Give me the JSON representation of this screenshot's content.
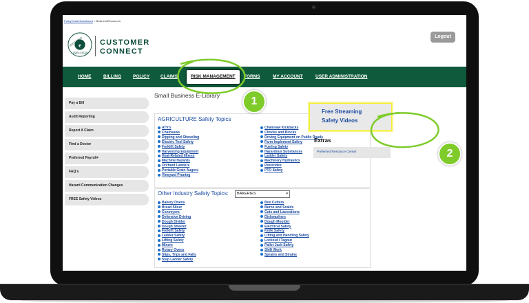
{
  "breadcrumb": {
    "home": "PolicyHolderDashboard",
    "current": "BusinessResources"
  },
  "brand": {
    "line1": "CUSTOMER",
    "line2": "CONNECT",
    "logo_text": "PREFERRED EMPLOYERS"
  },
  "header": {
    "logout_label": "Logout"
  },
  "nav": {
    "items": [
      "HOME",
      "BILLING",
      "POLICY",
      "CLAIMS",
      "RISK MANAGEMENT",
      "FORMS",
      "MY ACCOUNT",
      "USER ADMINISTRATION"
    ]
  },
  "sidebar": {
    "items": [
      "Pay a Bill",
      "Audit Reporting",
      "Report A Claim",
      "Find a Doctor",
      "Preferred Payroll+",
      "FAQ's",
      "Hazard Communication Changes",
      "FREE Safety Videos"
    ]
  },
  "library_title": "Small Business E-Library",
  "agriculture": {
    "title": "AGRICULTURE Safety Topics",
    "left": [
      "ATV's",
      "Chainsaws",
      "Dipping and Shoveling",
      "Electric Tool Safety",
      "Forklift Safety",
      "Harvesting Equipment",
      "Heat-Related Illness",
      "Machine Hazards",
      "Orchard Ladders",
      "Portable Grain Augers",
      "Vineyard Pruning"
    ],
    "right": [
      "Chainsaw Kickbacks",
      "Chocks and Blocks",
      "Driving Equipment on Public Roads",
      "Farm Implement Safety",
      "Fueling Safety",
      "Hazardous Substances",
      "Ladder Safety",
      "Machinery Hydraulics",
      "Pesticides",
      "PTO Safety"
    ]
  },
  "other": {
    "title": "Other Industry Safety Topics:",
    "selected": "BAKERIES",
    "left": [
      "Bakery Ovens",
      "Bread Slicer",
      "Conveyors",
      "Defensive Driving",
      "Dough Divider",
      "Dough Sheeter",
      "Forklift Safety",
      "Ladder Safety",
      "Lifting Safety",
      "Mixers",
      "Rotary Ovens",
      "Slips, Trips and Falls",
      "Step Ladder Safety"
    ],
    "right": [
      "Box Cutters",
      "Burns and Scalds",
      "Cuts and Lacerations",
      "Dishwashers",
      "Dough Moulder",
      "Electrical Safety",
      "Knife Safety",
      "Lifting and Handling Safety",
      "Lockout / Tagout",
      "Pallet Jack Safety",
      "Shift Work",
      "Sprains and Strains"
    ]
  },
  "streaming": {
    "line1": "Free Streaming",
    "line2": "Safety Videos"
  },
  "extras": {
    "title": "Extras",
    "link": "Preferred Resource Center"
  },
  "badges": {
    "one": "1",
    "two": "2"
  },
  "colors": {
    "nav_bg": "#0f5a3c",
    "brand": "#0d4d3c",
    "link": "#1a4aa0",
    "badge": "#7ecb2a"
  }
}
